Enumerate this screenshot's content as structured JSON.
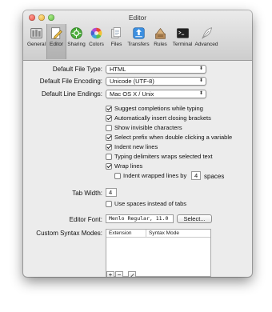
{
  "window": {
    "title": "Editor"
  },
  "toolbar": {
    "items": [
      {
        "label": "General",
        "icon": "general-icon"
      },
      {
        "label": "Editor",
        "icon": "pencil-icon"
      },
      {
        "label": "Sharing",
        "icon": "sharing-icon"
      },
      {
        "label": "Colors",
        "icon": "color-wheel-icon"
      },
      {
        "label": "Files",
        "icon": "files-icon"
      },
      {
        "label": "Transfers",
        "icon": "transfers-icon"
      },
      {
        "label": "Rules",
        "icon": "rules-icon"
      },
      {
        "label": "Terminal",
        "icon": "terminal-icon"
      },
      {
        "label": "Advanced",
        "icon": "feather-icon"
      }
    ],
    "selected": "Editor"
  },
  "form": {
    "default_file_type": {
      "label": "Default File Type:",
      "value": "HTML"
    },
    "default_file_encoding": {
      "label": "Default File Encoding:",
      "value": "Unicode (UTF-8)"
    },
    "default_line_endings": {
      "label": "Default Line Endings:",
      "value": "Mac OS X / Unix"
    },
    "options": [
      {
        "label": "Suggest completions while typing",
        "checked": true
      },
      {
        "label": "Automatically insert closing brackets",
        "checked": true
      },
      {
        "label": "Show invisible characters",
        "checked": false
      },
      {
        "label": "Select prefix when double clicking a variable",
        "checked": true
      },
      {
        "label": "Indent new lines",
        "checked": true
      },
      {
        "label": "Typing delimiters wraps selected text",
        "checked": false
      },
      {
        "label": "Wrap lines",
        "checked": true
      }
    ],
    "indent_wrapped": {
      "label": "Indent wrapped lines by",
      "checked": false,
      "value": "4",
      "unit": "spaces"
    },
    "tab_width": {
      "label": "Tab Width:",
      "value": "4"
    },
    "use_spaces": {
      "label": "Use spaces instead of tabs",
      "checked": false
    },
    "editor_font": {
      "label": "Editor Font:",
      "value": "Menlo Regular, 11.0",
      "button": "Select..."
    },
    "syntax_modes": {
      "label": "Custom Syntax Modes:",
      "columns": [
        "Extension",
        "Syntax Mode"
      ],
      "add": "+",
      "remove": "−"
    }
  }
}
